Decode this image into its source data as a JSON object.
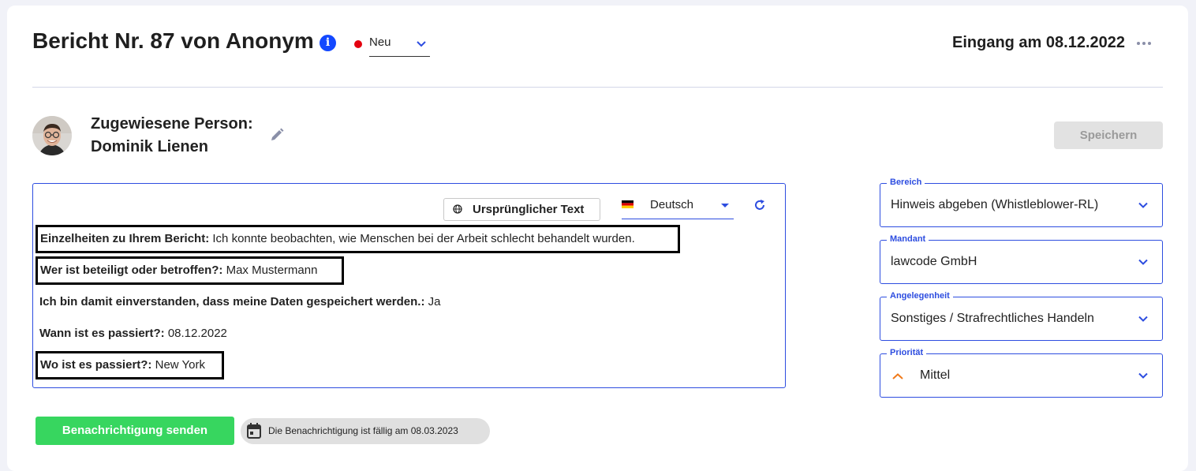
{
  "header": {
    "title": "Bericht Nr. 87 von Anonym",
    "status": "Neu",
    "status_color": "#e4000f",
    "received": "Eingang am 08.12.2022"
  },
  "assignee": {
    "label": "Zugewiesene Person:",
    "name": "Dominik Lienen",
    "save_label": "Speichern"
  },
  "report": {
    "original_text_label": "Ursprünglicher Text",
    "language": "Deutsch",
    "fields": [
      {
        "label": "Einzelheiten zu Ihrem Bericht:",
        "value": "Ich konnte beobachten, wie Menschen bei der Arbeit schlecht behandelt wurden."
      },
      {
        "label": "Wer ist beteiligt oder betroffen?:",
        "value": "Max Mustermann"
      },
      {
        "label": "Ich bin damit einverstanden, dass meine Daten gespeichert werden.:",
        "value": "Ja"
      },
      {
        "label": "Wann ist es passiert?:",
        "value": "08.12.2022"
      },
      {
        "label": "Wo ist es passiert?:",
        "value": "New York"
      }
    ]
  },
  "sidebar": {
    "bereich": {
      "label": "Bereich",
      "value": "Hinweis abgeben (Whistleblower-RL)"
    },
    "mandant": {
      "label": "Mandant",
      "value": "lawcode GmbH"
    },
    "angelegenheit": {
      "label": "Angelegenheit",
      "value": "Sonstiges / Strafrechtliches Handeln"
    },
    "prioritaet": {
      "label": "Priorität",
      "value": "Mittel",
      "icon_color": "#f07a1a"
    }
  },
  "footer": {
    "send_label": "Benachrichtigung senden",
    "due_text": "Die Benachrichtigung ist fällig am 08.03.2023"
  },
  "colors": {
    "accent": "#2d4de0",
    "info": "#1348ff",
    "send": "#37d65f"
  }
}
